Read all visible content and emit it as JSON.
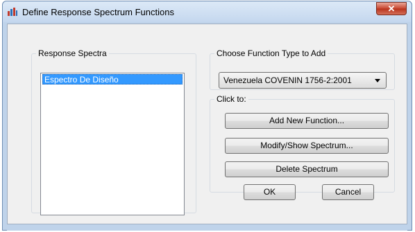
{
  "window": {
    "title": "Define Response Spectrum Functions",
    "close_icon": "close-icon"
  },
  "response_spectra": {
    "legend": "Response Spectra",
    "items": [
      "Espectro De Diseño"
    ],
    "selected_index": 0
  },
  "function_type": {
    "legend": "Choose  Function Type to Add",
    "selected": "Venezuela COVENIN 1756-2:2001"
  },
  "click_to": {
    "legend": "Click to:",
    "add_new": "Add New Function...",
    "modify_show": "Modify/Show Spectrum...",
    "delete": "Delete Spectrum"
  },
  "footer": {
    "ok": "OK",
    "cancel": "Cancel"
  },
  "colors": {
    "selection": "#3399ff",
    "titlebar": "#c4d7ee",
    "close_button": "#c7462f"
  }
}
